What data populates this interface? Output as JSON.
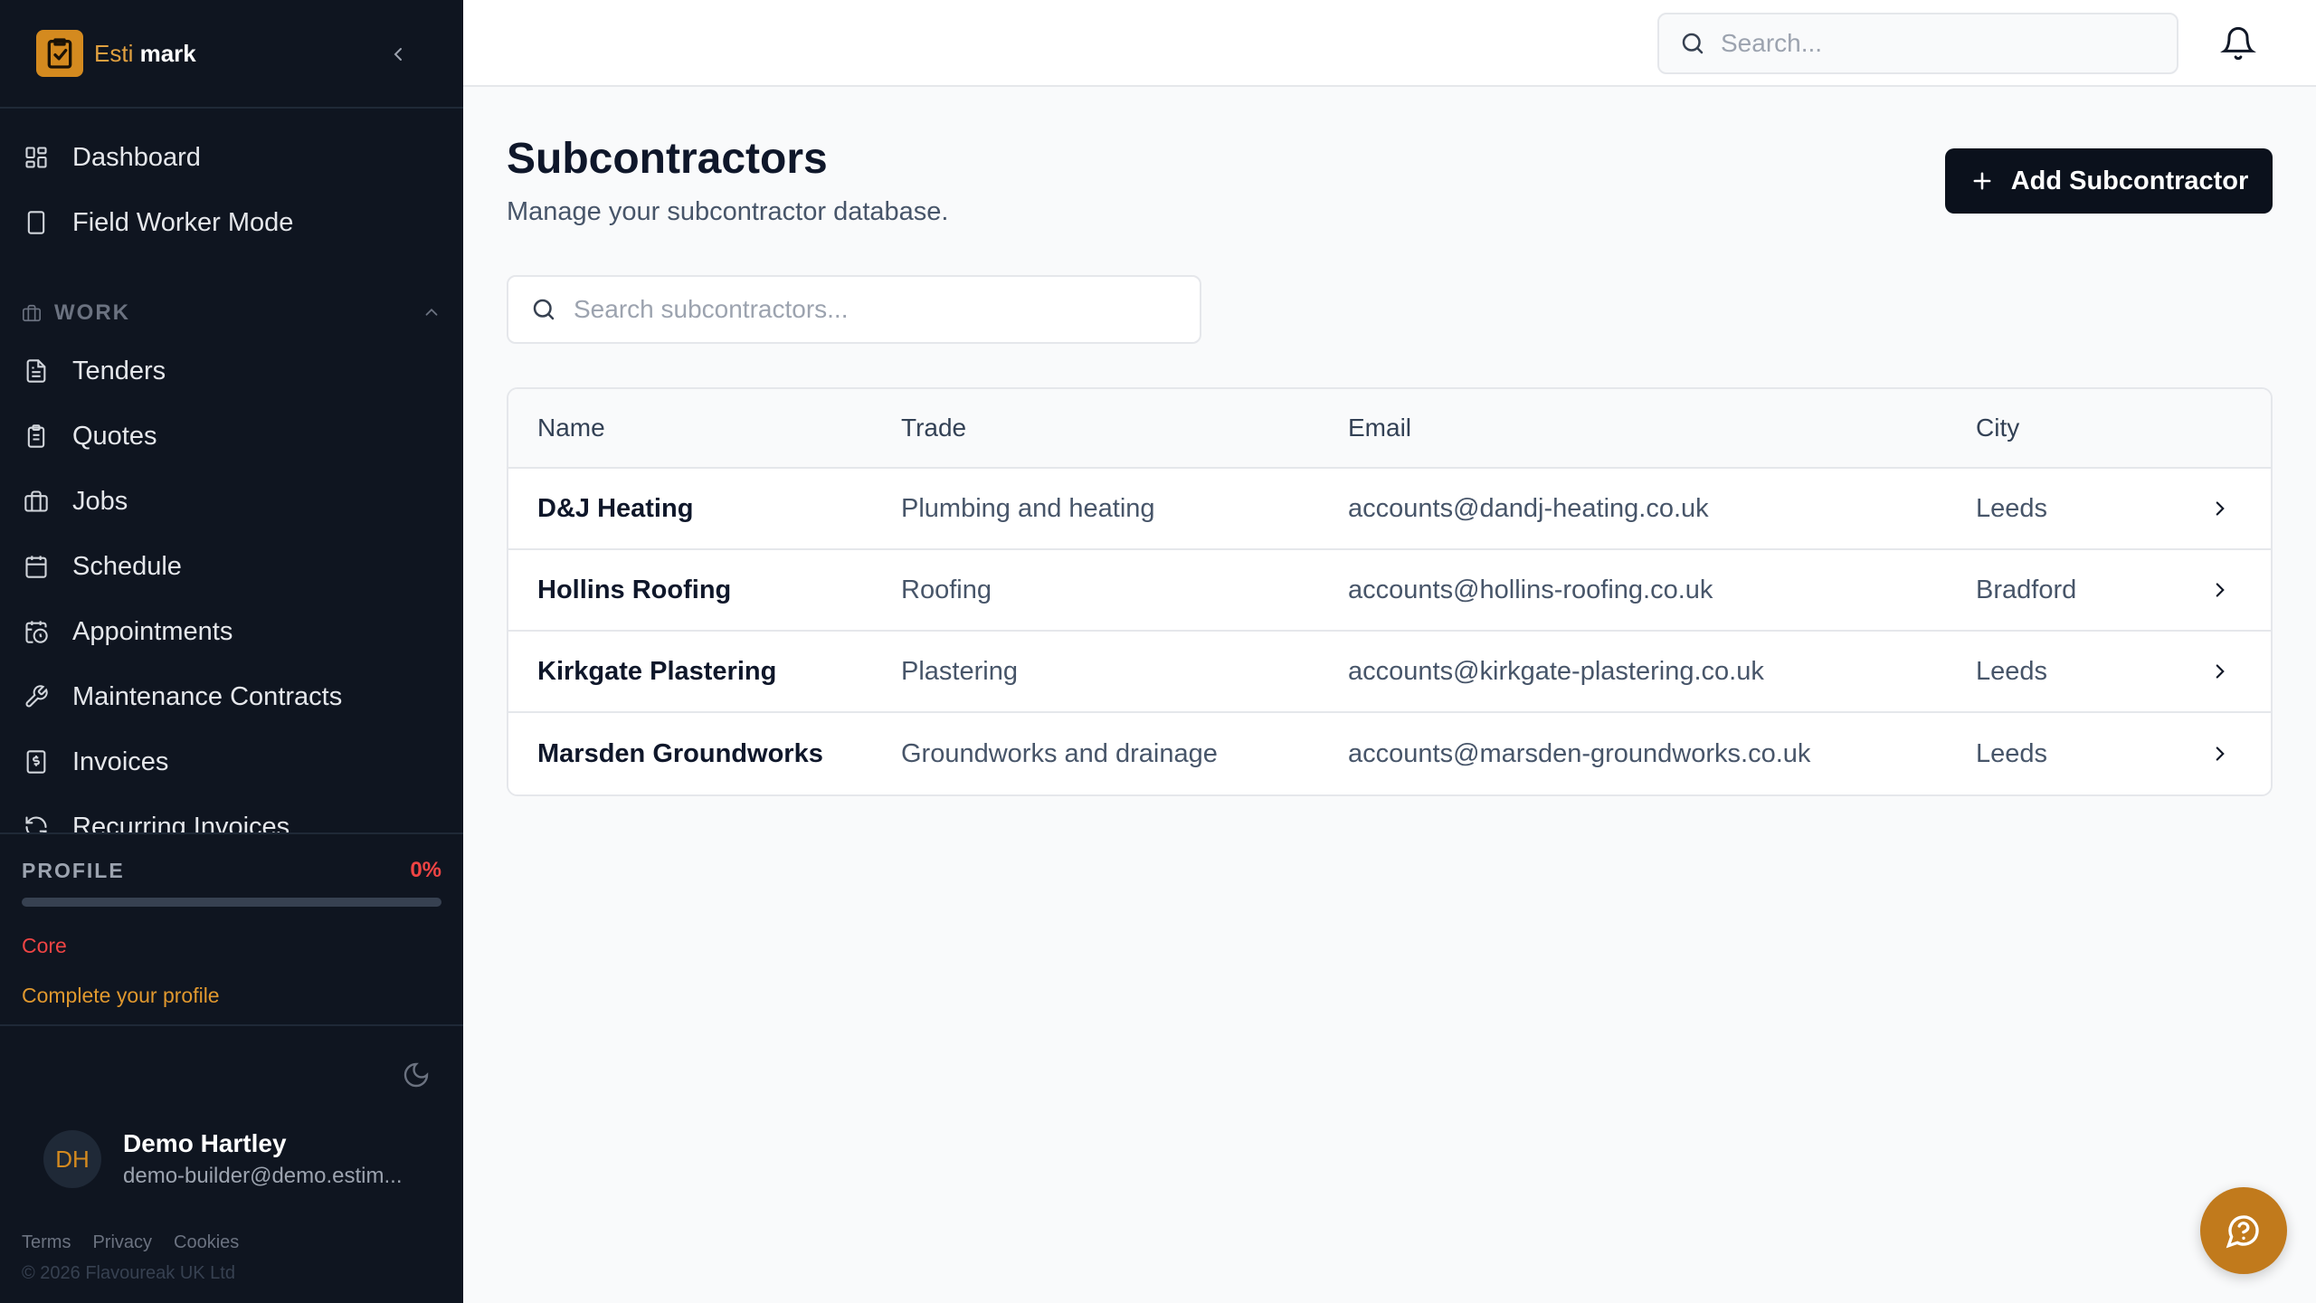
{
  "brand": {
    "name_part1": "Esti",
    "name_part2": "mark",
    "accent": "#d48a1f",
    "logo_icon": "checklist-logo-icon"
  },
  "sidebar": {
    "top_items": [
      {
        "label": "Dashboard",
        "icon": "dashboard-grid-icon"
      },
      {
        "label": "Field Worker Mode",
        "icon": "tablet-icon"
      }
    ],
    "section": {
      "label": "WORK",
      "icon": "briefcase-icon",
      "expanded": true
    },
    "work_items": [
      {
        "label": "Tenders",
        "icon": "document-icon"
      },
      {
        "label": "Quotes",
        "icon": "clipboard-icon"
      },
      {
        "label": "Jobs",
        "icon": "briefcase-icon"
      },
      {
        "label": "Schedule",
        "icon": "calendar-icon"
      },
      {
        "label": "Appointments",
        "icon": "calendar-clock-icon"
      },
      {
        "label": "Maintenance Contracts",
        "icon": "wrench-icon"
      },
      {
        "label": "Invoices",
        "icon": "receipt-icon"
      },
      {
        "label": "Recurring Invoices",
        "icon": "refresh-icon"
      }
    ],
    "profile": {
      "title": "PROFILE",
      "percent_label": "0%",
      "progress": 0,
      "tier": "Core",
      "cta": "Complete your profile"
    },
    "user": {
      "initials": "DH",
      "name": "Demo Hartley",
      "email": "demo-builder@demo.estim..."
    },
    "footer_links": [
      "Terms",
      "Privacy",
      "Cookies"
    ],
    "copyright": "© 2026 Flavoureak UK Ltd"
  },
  "topbar": {
    "search_placeholder": "Search...",
    "bell_icon": "bell-icon"
  },
  "page": {
    "title": "Subcontractors",
    "subtitle": "Manage your subcontractor database.",
    "add_button": "Add Subcontractor",
    "search_placeholder": "Search subcontractors..."
  },
  "table": {
    "columns": [
      "Name",
      "Trade",
      "Email",
      "City"
    ],
    "rows": [
      {
        "name": "D&J Heating",
        "trade": "Plumbing and heating",
        "email": "accounts@dandj-heating.co.uk",
        "city": "Leeds"
      },
      {
        "name": "Hollins Roofing",
        "trade": "Roofing",
        "email": "accounts@hollins-roofing.co.uk",
        "city": "Bradford"
      },
      {
        "name": "Kirkgate Plastering",
        "trade": "Plastering",
        "email": "accounts@kirkgate-plastering.co.uk",
        "city": "Leeds"
      },
      {
        "name": "Marsden Groundworks",
        "trade": "Groundworks and drainage",
        "email": "accounts@marsden-groundworks.co.uk",
        "city": "Leeds"
      }
    ]
  },
  "colors": {
    "sidebar_bg": "#0f1520",
    "primary_button": "#0b111c",
    "danger": "#ef4444",
    "chat_fab": "#c17a1c"
  }
}
